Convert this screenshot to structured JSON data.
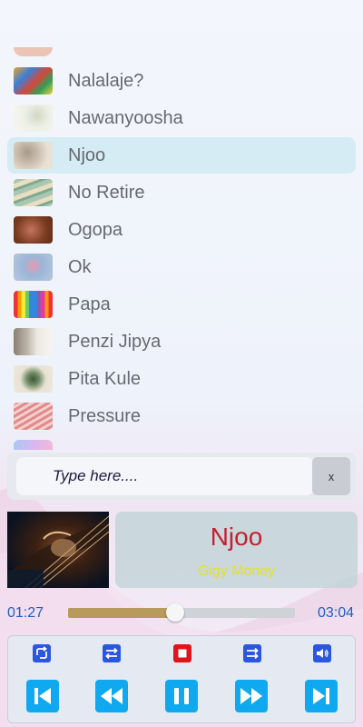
{
  "playlist": {
    "items": [
      {
        "label": "Nalalaje?",
        "thumb": "thumb-art-icon"
      },
      {
        "label": "Nawanyoosha",
        "thumb": "thumb-art-icon"
      },
      {
        "label": "Njoo",
        "thumb": "thumb-art-icon",
        "active": true
      },
      {
        "label": "No Retire",
        "thumb": "thumb-art-icon"
      },
      {
        "label": "Ogopa",
        "thumb": "thumb-art-icon"
      },
      {
        "label": "Ok",
        "thumb": "thumb-art-icon"
      },
      {
        "label": "Papa",
        "thumb": "thumb-art-icon"
      },
      {
        "label": "Penzi Jipya",
        "thumb": "thumb-art-icon"
      },
      {
        "label": "Pita Kule",
        "thumb": "thumb-art-icon"
      },
      {
        "label": "Pressure",
        "thumb": "thumb-art-icon"
      }
    ],
    "active_color": "#d5ecf4"
  },
  "search": {
    "placeholder": "Type here....",
    "clear_label": "x"
  },
  "now_playing": {
    "title": "Njoo",
    "artist": "Gigy Money",
    "title_color": "#c4202f",
    "artist_color": "#e4e226"
  },
  "progress": {
    "elapsed": "01:27",
    "total": "03:04",
    "fraction": 0.47
  },
  "controls": {
    "small": [
      {
        "name": "repeat-icon"
      },
      {
        "name": "loop-icon"
      },
      {
        "name": "stop-icon"
      },
      {
        "name": "shuffle-icon"
      },
      {
        "name": "volume-icon"
      }
    ],
    "big": [
      {
        "name": "skip-previous-icon"
      },
      {
        "name": "rewind-icon"
      },
      {
        "name": "pause-icon"
      },
      {
        "name": "fast-forward-icon"
      },
      {
        "name": "skip-next-icon"
      }
    ],
    "accent": "#10a9f0",
    "small_color": "#2a56e0",
    "stop_color": "#e0141b"
  }
}
